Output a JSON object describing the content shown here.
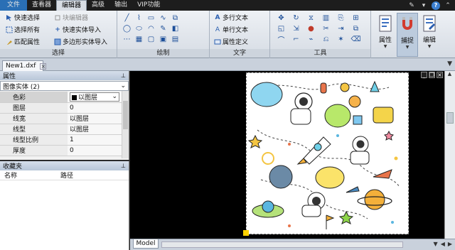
{
  "menu": {
    "items": [
      "文件",
      "查看器",
      "编辑器",
      "高级",
      "输出",
      "VIP功能"
    ],
    "active_index": 2
  },
  "ribbon": {
    "select_group": {
      "title": "选择",
      "quick_select": "快速选择",
      "select_all": "选择所有",
      "match_props": "匹配属性",
      "block_editor": "块编辑器",
      "quick_entity_import": "快速实体导入",
      "polygon_entity_import": "多边形实体导入"
    },
    "draw_group": {
      "title": "绘制"
    },
    "text_group": {
      "title": "文字",
      "mtext": "多行文本",
      "stext": "单行文本",
      "attdef": "属性定义"
    },
    "tools_group": {
      "title": "工具"
    },
    "big_buttons": {
      "properties": "属性",
      "snap": "捕捉",
      "edit": "编辑"
    }
  },
  "document": {
    "tab_label": "New1.dxf"
  },
  "properties_panel": {
    "title": "属性",
    "entity_select": "图像实体 (2)",
    "rows": [
      {
        "key": "色彩",
        "value": "以图层"
      },
      {
        "key": "图层",
        "value": "0"
      },
      {
        "key": "线宽",
        "value": "以图层"
      },
      {
        "key": "线型",
        "value": "以图层"
      },
      {
        "key": "线型比例",
        "value": "1"
      },
      {
        "key": "厚度",
        "value": "0"
      }
    ]
  },
  "favorites_panel": {
    "title": "收藏夹",
    "columns": [
      "名称",
      "路径"
    ]
  },
  "bottom": {
    "model_tab": "Model"
  },
  "colors": {
    "menu_bg": "#1d1d1d",
    "file_menu": "#2a6fb5",
    "canvas_bg": "#000000",
    "ucs_marker": "#ffd200"
  }
}
